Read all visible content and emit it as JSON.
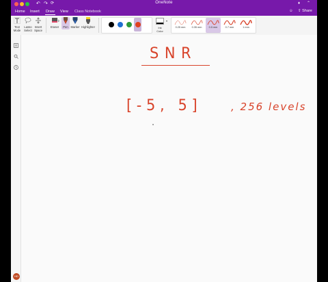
{
  "window": {
    "title": "OneNote",
    "titlebar_colour": "#7719aa",
    "traffic_lights": [
      "#ff5f57",
      "#febc2e",
      "#28c840"
    ],
    "titlebar_icons": [
      "undo-icon",
      "redo-icon",
      "sync-icon",
      "bell-icon",
      "collapse-icon"
    ]
  },
  "tabs": [
    {
      "label": "Home"
    },
    {
      "label": "Insert"
    },
    {
      "label": "Draw",
      "active": true
    },
    {
      "label": "View"
    },
    {
      "label": "Class Notebook"
    }
  ],
  "share": {
    "label": "Share"
  },
  "ribbon": {
    "tools": [
      {
        "label_l1": "Text",
        "label_l2": "Mode",
        "icon": "text-mode-icon"
      },
      {
        "label_l1": "Lasso",
        "label_l2": "Select",
        "icon": "lasso-icon"
      },
      {
        "label_l1": "Insert",
        "label_l2": "Space",
        "icon": "insert-space-icon"
      }
    ],
    "pens": [
      {
        "label": "Eraser",
        "icon": "eraser-icon"
      },
      {
        "label": "Pen",
        "icon": "pen-icon",
        "selected": true
      },
      {
        "label": "Marker",
        "icon": "marker-icon"
      },
      {
        "label": "Highlighter",
        "icon": "highlighter-icon"
      }
    ],
    "colors": [
      "#000000",
      "#1f6fd1",
      "#2c9a3a",
      "#e0411e"
    ],
    "selected_color": "#e0411e",
    "ink_color": {
      "label_l1": "Ink",
      "label_l2": "Color"
    },
    "thickness": [
      {
        "label": "0.25 mm"
      },
      {
        "label": "0.35 mm"
      },
      {
        "label": "0.5 mm",
        "selected": true
      },
      {
        "label": "0.7 mm"
      },
      {
        "label": "1 mm"
      }
    ]
  },
  "sidebar": {
    "icons": [
      "notebooks-icon",
      "search-icon",
      "recent-icon"
    ],
    "avatar_initials": "HD"
  },
  "canvas": {
    "ink_colour": "#d8432a",
    "strokes": [
      {
        "text": "SNR",
        "kind": "heading"
      },
      {
        "text": "[-5, 5]",
        "kind": "range"
      },
      {
        "text": ", 256 levels",
        "kind": "note"
      }
    ]
  }
}
